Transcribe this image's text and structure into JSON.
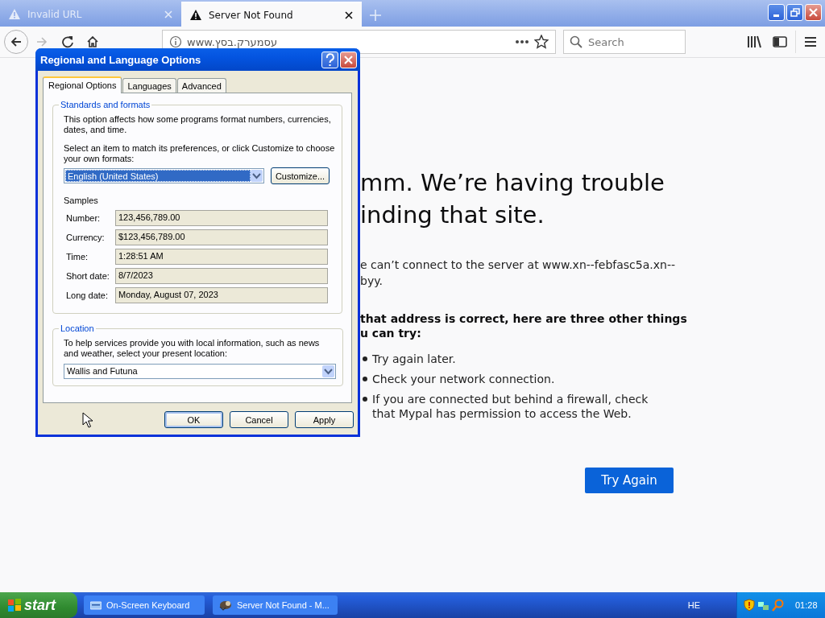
{
  "browser": {
    "tabs": [
      {
        "title": "Invalid URL",
        "selected": false
      },
      {
        "title": "Server Not Found",
        "selected": true
      }
    ],
    "address": "www.עסמערק.בסץ",
    "search": {
      "placeholder": "Search"
    }
  },
  "error_page": {
    "heading": [
      "mm. We’re having trouble",
      "inding that site."
    ],
    "message": [
      "e can’t connect to the server at www.xn--febfasc5a.xn--",
      "byy."
    ],
    "advice": [
      "that address is correct, here are three other things",
      "u can try:"
    ],
    "suggestions": [
      "Try again later.",
      "Check your network connection.",
      "If you are connected but behind a firewall, check that Mypal has permission to access the Web."
    ],
    "button": "Try Again"
  },
  "dialog": {
    "title": "Regional and Language Options",
    "tabs": [
      {
        "label": "Regional Options",
        "selected": true
      },
      {
        "label": "Languages",
        "selected": false
      },
      {
        "label": "Advanced",
        "selected": false
      }
    ],
    "standards": {
      "title": "Standards and formats",
      "description": "This option affects how some programs format numbers, currencies, dates, and time.",
      "prompt": "Select an item to match its preferences, or click Customize to choose your own formats:",
      "format": "English (United States)",
      "customize": "Customize...",
      "samples_label": "Samples",
      "samples": [
        {
          "label": "Number:",
          "value": "123,456,789.00"
        },
        {
          "label": "Currency:",
          "value": "$123,456,789.00"
        },
        {
          "label": "Time:",
          "value": "1:28:51 AM"
        },
        {
          "label": "Short date:",
          "value": "8/7/2023"
        },
        {
          "label": "Long date:",
          "value": "Monday, August 07, 2023"
        }
      ]
    },
    "location": {
      "title": "Location",
      "description": "To help services provide you with local information, such as news and weather, select your present location:",
      "value": "Wallis and Futuna"
    },
    "buttons": [
      "OK",
      "Cancel",
      "Apply"
    ]
  },
  "taskbar": {
    "start": "start",
    "tasks": [
      "On-Screen Keyboard",
      "Server Not Found - M..."
    ],
    "language": "HE",
    "clock": "01:28"
  }
}
